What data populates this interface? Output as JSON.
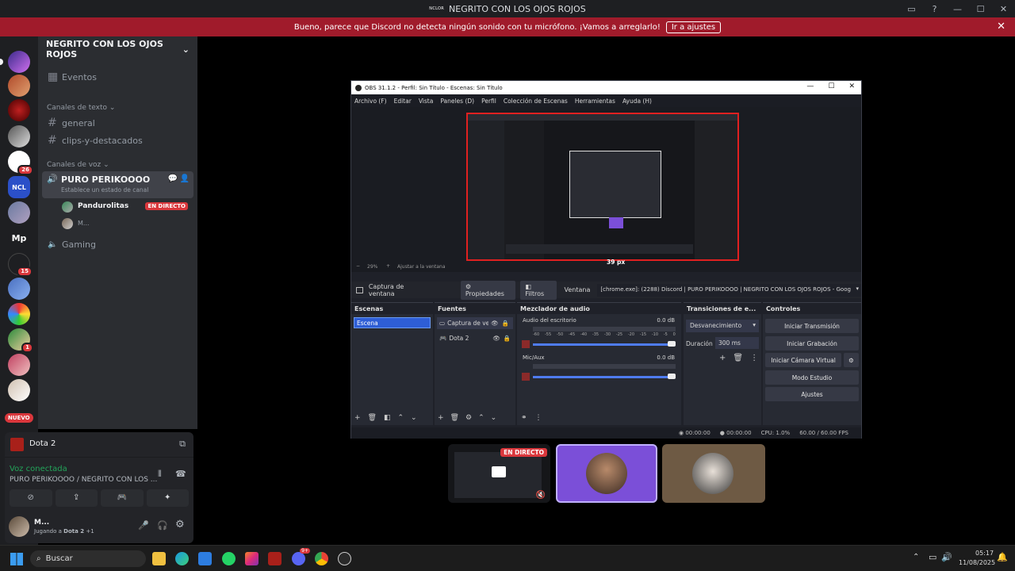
{
  "window": {
    "title": "NEGRITO CON LOS OJOS ROJOS",
    "logo_text": "NCLOR"
  },
  "banner": {
    "text": "Bueno, parece que Discord no detecta ningún sonido con tu micrófono. ¡Vamos a arreglarlo!",
    "button": "Ir a ajustes"
  },
  "guilds": {
    "badges": [
      "26",
      "15",
      "1"
    ],
    "mp_label": "Mp",
    "ncl_label": "NCL",
    "new_label": "NUEVO"
  },
  "server": {
    "name": "NEGRITO CON LOS OJOS ROJOS",
    "events": "Eventos",
    "text_category": "Canales de texto",
    "text_channels": [
      "general",
      "clips-y-destacados"
    ],
    "voice_category": "Canales de voz",
    "voice_channel": "PURO PERIKOOOO",
    "voice_status": "Establece un estado de canal",
    "voice_users": [
      {
        "name": "Pandurolitas",
        "live": "EN DIRECTO"
      },
      {
        "name": "M..."
      }
    ],
    "gaming": "Gaming"
  },
  "activity": {
    "game": "Dota 2"
  },
  "voice": {
    "status": "Voz conectada",
    "location": "PURO PERIKOOOO / NEGRITO CON LOS ..."
  },
  "user": {
    "name": "M...",
    "activity_prefix": "Jugando a",
    "activity_game": "Dota 2",
    "activity_extra": "+1"
  },
  "obs": {
    "title": "OBS 31.1.2 - Perfil: Sin Título - Escenas: Sin Título",
    "menu": [
      "Archivo (F)",
      "Editar",
      "Vista",
      "Paneles (D)",
      "Perfil",
      "Colección de Escenas",
      "Herramientas",
      "Ayuda (H)"
    ],
    "zoom": "29%",
    "fit": "Ajustar a la ventana",
    "px_label": "39 px",
    "source_name": "Captura de ventana",
    "props": "Propiedades",
    "filters": "Filtros",
    "window_label": "Ventana",
    "window_value": "[chrome.exe]: (2288) Discord | PURO PERIKOOOO | NEGRITO CON LOS OJOS ROJOS - Goog",
    "scenes_title": "Escenas",
    "scene": "Escena",
    "sources_title": "Fuentes",
    "sources": [
      "Captura de ve",
      "Dota 2"
    ],
    "mixer_title": "Mezclador de audio",
    "mixer": [
      {
        "name": "Audio del escritorio",
        "db": "0.0 dB"
      },
      {
        "name": "Mic/Aux",
        "db": "0.0 dB"
      }
    ],
    "meter_ticks": [
      "-60",
      "-55",
      "-50",
      "-45",
      "-40",
      "-35",
      "-30",
      "-25",
      "-20",
      "-15",
      "-10",
      "-5",
      "0"
    ],
    "transitions_title": "Transiciones de e...",
    "transition": "Desvanecimiento",
    "duration_label": "Duración",
    "duration_value": "300 ms",
    "controls_title": "Controles",
    "controls": [
      "Iniciar Transmisión",
      "Iniciar Grabación",
      "Iniciar Cámara Virtual",
      "Modo Estudio",
      "Ajustes"
    ],
    "status": {
      "time1": "00:00:00",
      "time2": "00:00:00",
      "cpu": "CPU: 1.0%",
      "fps": "60.00 / 60.00 FPS"
    }
  },
  "stream_tile": {
    "live": "EN DIRECTO"
  },
  "taskbar": {
    "search": "Buscar",
    "time": "05:17",
    "date": "11/08/2025",
    "badge": "9+"
  }
}
